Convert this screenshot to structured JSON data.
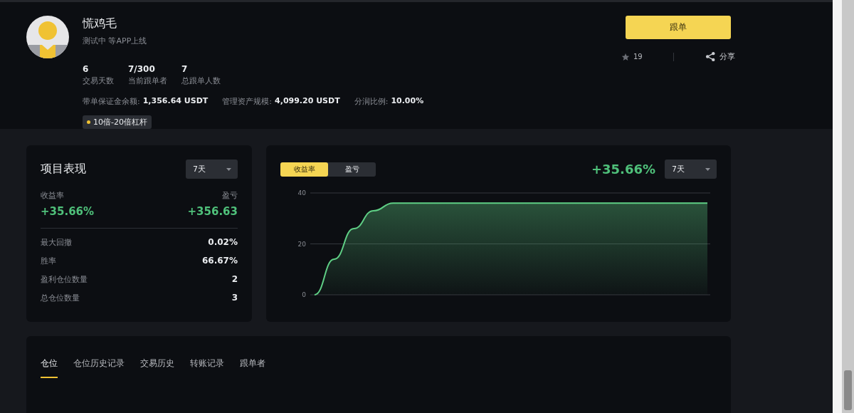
{
  "profile": {
    "name": "慌鸡毛",
    "bio": "测试中 等APP上线",
    "stats": [
      {
        "value": "6",
        "label": "交易天数"
      },
      {
        "value": "7/300",
        "label": "当前跟单者"
      },
      {
        "value": "7",
        "label": "总跟单人数"
      }
    ],
    "facts": [
      {
        "label": "带单保证金余额:",
        "value": "1,356.64 USDT"
      },
      {
        "label": "管理资产规模:",
        "value": "4,099.20 USDT"
      },
      {
        "label": "分润比例:",
        "value": "10.00%"
      }
    ],
    "tag": {
      "text": "10倍-20倍杠杆",
      "color": "#f0c233"
    }
  },
  "actions": {
    "follow_button": "跟单",
    "favorites": "19",
    "share": "分享"
  },
  "performance": {
    "title": "项目表现",
    "period": "7天",
    "headline": [
      {
        "label": "收益率",
        "value": "+35.66%"
      },
      {
        "label": "盈亏",
        "value": "+356.63"
      }
    ],
    "rows": [
      {
        "label": "最大回撤",
        "value": "0.02%"
      },
      {
        "label": "胜率",
        "value": "66.67%"
      },
      {
        "label": "盈利仓位数量",
        "value": "2"
      },
      {
        "label": "总仓位数量",
        "value": "3"
      }
    ]
  },
  "chart_panel": {
    "tabs": [
      {
        "label": "收益率",
        "selected": true
      },
      {
        "label": "盈亏",
        "selected": false
      }
    ],
    "total": "+35.66%",
    "period": "7天",
    "chart_data": {
      "type": "area",
      "series": [
        {
          "color": "#5fcf85",
          "values": [
            0,
            14,
            26,
            33,
            36,
            36,
            36,
            36,
            36,
            36,
            36,
            36,
            36,
            36,
            36,
            36,
            36,
            36,
            36,
            36,
            36
          ]
        }
      ],
      "ylim": [
        0,
        40
      ],
      "yticks": [
        0,
        20,
        40
      ]
    }
  },
  "records": {
    "tabs": [
      {
        "label": "仓位",
        "selected": true
      },
      {
        "label": "仓位历史记录",
        "selected": false
      },
      {
        "label": "交易历史",
        "selected": false
      },
      {
        "label": "转账记录",
        "selected": false
      },
      {
        "label": "跟单者",
        "selected": false
      }
    ]
  }
}
